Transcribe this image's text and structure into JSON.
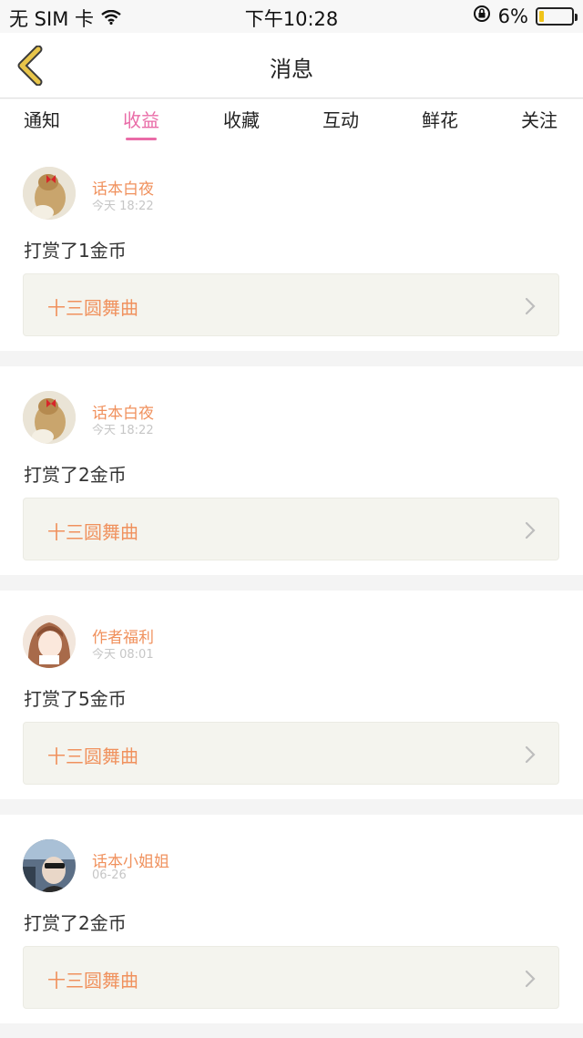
{
  "status_bar": {
    "carrier": "无 SIM 卡",
    "time": "下午10:28",
    "battery_percent": "6%",
    "battery_level": 0.06
  },
  "nav": {
    "title": "消息"
  },
  "tabs": [
    {
      "label": "通知"
    },
    {
      "label": "收益",
      "active": true
    },
    {
      "label": "收藏"
    },
    {
      "label": "互动"
    },
    {
      "label": "鲜花"
    },
    {
      "label": "关注"
    }
  ],
  "items": [
    {
      "name": "话本白夜",
      "time": "今天 18:22",
      "reward": "打赏了1金币",
      "book": "十三圆舞曲",
      "avatar": "hair-bun-avatar"
    },
    {
      "name": "话本白夜",
      "time": "今天 18:22",
      "reward": "打赏了2金币",
      "book": "十三圆舞曲",
      "avatar": "hair-bun-avatar"
    },
    {
      "name": "作者福利",
      "time": "今天 08:01",
      "reward": "打赏了5金币",
      "book": "十三圆舞曲",
      "avatar": "anime-girl-avatar"
    },
    {
      "name": "话本小姐姐",
      "time": "06-26",
      "reward": "打赏了2金币",
      "book": "十三圆舞曲",
      "avatar": "car-selfie-avatar"
    }
  ],
  "colors": {
    "accent_pink": "#e96ba7",
    "accent_orange": "#f0915d",
    "back_arrow": "#e8c54a"
  }
}
